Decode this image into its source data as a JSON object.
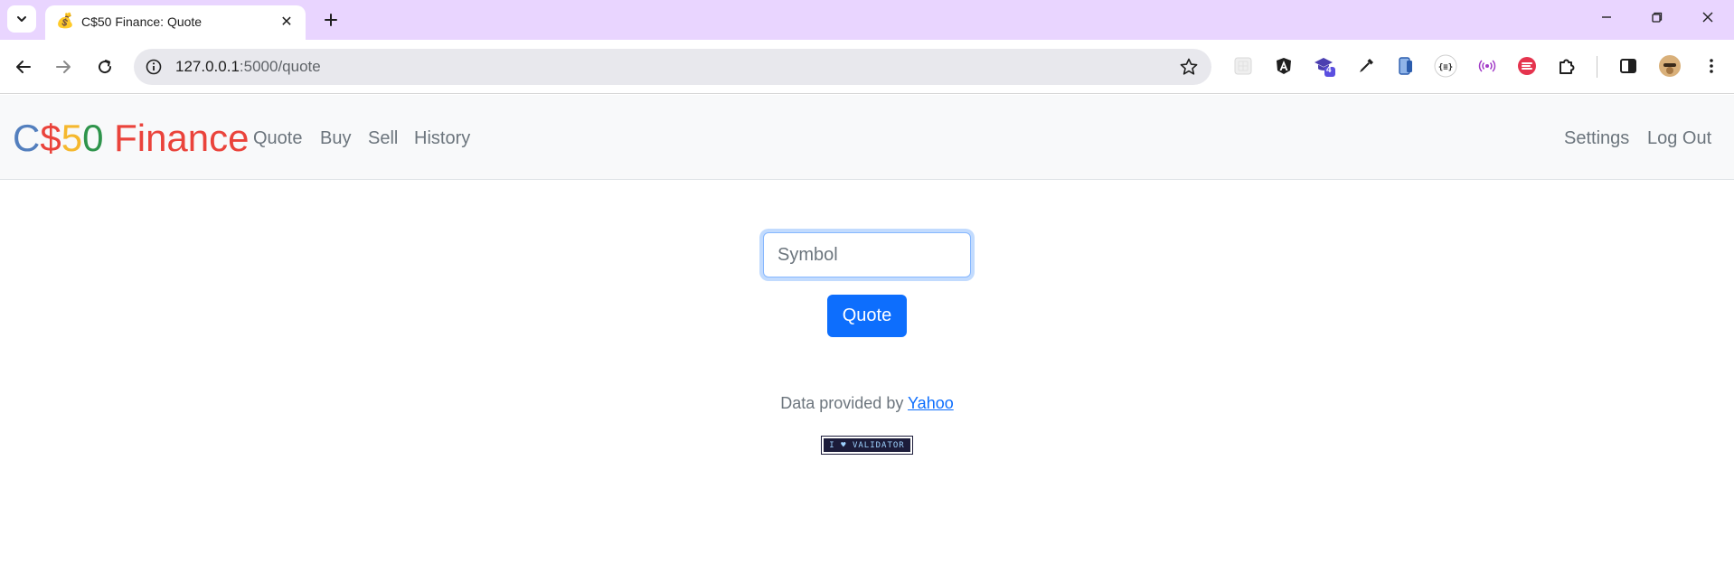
{
  "browser": {
    "tab": {
      "favicon": "💰",
      "title": "C$50 Finance: Quote"
    },
    "url": {
      "host": "127.0.0.1",
      "rest": ":5000/quote"
    },
    "extensions": [
      "grid-extension-icon",
      "angular-devtools-icon",
      "graduation-cap-extension-icon",
      "eyedropper-icon",
      "mobile-view-icon",
      "json-viewer-icon",
      "broadcast-icon",
      "toggl-icon",
      "extensions-puzzle-icon",
      "side-panel-icon"
    ],
    "ext_badge": "4"
  },
  "brand": {
    "c": "C",
    "dollar": "$",
    "five": "5",
    "zero": "0",
    "finance": " Finance"
  },
  "nav": {
    "left": [
      "Quote",
      "Buy",
      "Sell",
      "History"
    ],
    "right": [
      "Settings",
      "Log Out"
    ]
  },
  "form": {
    "symbol_placeholder": "Symbol",
    "symbol_value": "",
    "submit_label": "Quote"
  },
  "footer": {
    "prefix": "Data provided by ",
    "link": "Yahoo",
    "validator_badge": "I ♥ VALIDATOR"
  },
  "colors": {
    "accent": "#0d6efd",
    "tabbar": "#e9d5ff",
    "brand_blue": "#537fbe",
    "brand_red": "#ea433b",
    "brand_yellow": "#f5b82e",
    "brand_green": "#2e944b"
  }
}
